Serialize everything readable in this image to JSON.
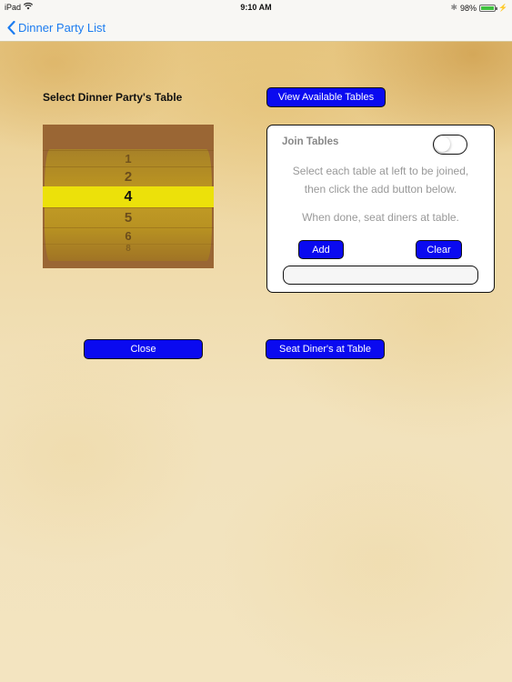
{
  "status_bar": {
    "device": "iPad",
    "time": "9:10 AM",
    "battery": "98%",
    "battery_level": 0.98
  },
  "nav": {
    "back_label": "Dinner Party List"
  },
  "main": {
    "select_label": "Select Dinner Party's Table",
    "view_tables_button": "View Available Tables",
    "picker": {
      "rows": [
        "1",
        "2",
        "4",
        "5",
        "6",
        "8"
      ],
      "selected": "4"
    },
    "join_panel": {
      "title": "Join Tables",
      "toggle_on": false,
      "instruction_line1": "Select each table at left to  be joined,",
      "instruction_line2": "then click the add button below.",
      "instruction_line3": "When done, seat diners at table.",
      "add_button": "Add",
      "clear_button": "Clear",
      "joined_value": ""
    },
    "close_button": "Close",
    "seat_button": "Seat Diner's at Table"
  },
  "colors": {
    "button_blue": "#0a0af0",
    "nav_blue": "#1c7cf0",
    "picker_highlight": "#ece10a"
  }
}
